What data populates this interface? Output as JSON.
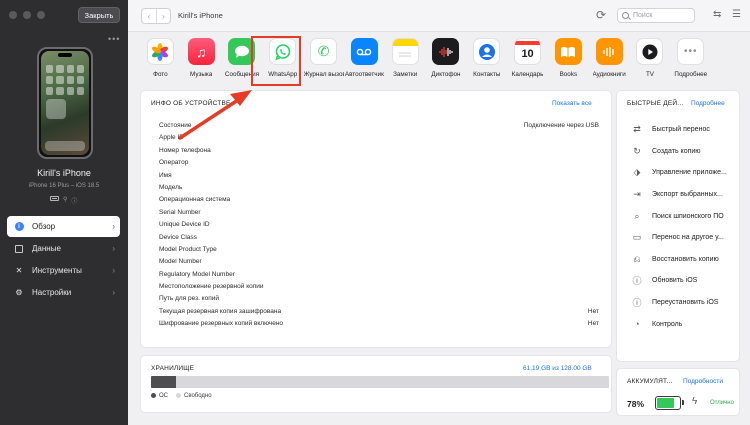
{
  "sidebar": {
    "close_label": "Закрыть",
    "device_name": "Kirill's iPhone",
    "device_model": "iPhone 16 Plus – iOS 18.5",
    "items": [
      {
        "label": "Обзор",
        "icon": "info-icon",
        "active": true
      },
      {
        "label": "Данные",
        "icon": "data-icon",
        "active": false
      },
      {
        "label": "Инструменты",
        "icon": "tools-icon",
        "active": false
      },
      {
        "label": "Настройки",
        "icon": "settings-icon",
        "active": false
      }
    ]
  },
  "topbar": {
    "title": "Kirill's iPhone",
    "search_placeholder": "Поиск"
  },
  "apps": [
    {
      "label": "Фото",
      "icon": "photos-icon"
    },
    {
      "label": "Музыка",
      "icon": "music-icon"
    },
    {
      "label": "Сообщения",
      "icon": "messages-icon"
    },
    {
      "label": "WhatsApp",
      "icon": "whatsapp-icon"
    },
    {
      "label": "Журнал вызовов",
      "icon": "call-log-icon"
    },
    {
      "label": "Автоответчик",
      "icon": "voicemail-icon"
    },
    {
      "label": "Заметки",
      "icon": "notes-icon"
    },
    {
      "label": "Диктофон",
      "icon": "voice-memos-icon"
    },
    {
      "label": "Контакты",
      "icon": "contacts-icon"
    },
    {
      "label": "Календарь",
      "icon": "calendar-icon",
      "day": "10"
    },
    {
      "label": "Books",
      "icon": "books-icon"
    },
    {
      "label": "Аудиокниги",
      "icon": "audiobooks-icon"
    },
    {
      "label": "TV",
      "icon": "tv-icon"
    },
    {
      "label": "Подробнее",
      "icon": "more-icon"
    }
  ],
  "device_info": {
    "title": "ИНФО ОБ УСТРОЙСТВЕ",
    "show_all": "Показать все",
    "rows": [
      {
        "label": "Состояние",
        "value": "Подключение через USB"
      },
      {
        "label": "Apple ID",
        "value": ""
      },
      {
        "label": "Номер телефона",
        "value": ""
      },
      {
        "label": "Оператор",
        "value": ""
      },
      {
        "label": "Имя",
        "value": ""
      },
      {
        "label": "Модель",
        "value": ""
      },
      {
        "label": "Операционная система",
        "value": ""
      },
      {
        "label": "Serial Number",
        "value": ""
      },
      {
        "label": "Unique Device ID",
        "value": ""
      },
      {
        "label": "Device Class",
        "value": ""
      },
      {
        "label": "Model Product Type",
        "value": ""
      },
      {
        "label": "Model Number",
        "value": ""
      },
      {
        "label": "Regulatory Model Number",
        "value": ""
      },
      {
        "label": "Местоположение резервной копии",
        "value": ""
      },
      {
        "label": "Путь для рез. копий",
        "value": ""
      },
      {
        "label": "Текущая резервная копия зашифрована",
        "value": "Нет"
      },
      {
        "label": "Шифрование резервных копий включено",
        "value": "Нет"
      }
    ]
  },
  "quick_actions": {
    "title": "БЫСТРЫЕ ДЕЙ...",
    "more": "Подробнее",
    "items": [
      {
        "label": "Быстрый перенос",
        "icon": "transfer-icon"
      },
      {
        "label": "Создать копию",
        "icon": "backup-icon"
      },
      {
        "label": "Управление приложе...",
        "icon": "apps-manage-icon"
      },
      {
        "label": "Экспорт выбранных...",
        "icon": "export-icon"
      },
      {
        "label": "Поиск шпионского ПО",
        "icon": "spyware-scan-icon"
      },
      {
        "label": "Перенос на другое у...",
        "icon": "device-transfer-icon"
      },
      {
        "label": "Восстановить копию",
        "icon": "restore-icon"
      },
      {
        "label": "Обновить iOS",
        "icon": "ios-update-icon"
      },
      {
        "label": "Переустановить iOS",
        "icon": "ios-reinstall-icon"
      },
      {
        "label": "Контроль",
        "icon": "control-icon"
      }
    ]
  },
  "storage": {
    "title": "ХРАНИЛИЩЕ",
    "summary": "61.19 GB из 128.00 GB",
    "used_fraction": 0.055,
    "legend": [
      {
        "label": "ОС",
        "color": "#4d4d52"
      },
      {
        "label": "Свободно",
        "color": "#d8d8dc"
      }
    ]
  },
  "battery": {
    "title": "АККУМУЛЯТ...",
    "more": "Подробности",
    "percent_label": "78%",
    "level": 0.78,
    "status": "Отлично"
  },
  "colors": {
    "accent": "#1a73e8",
    "highlight": "#e53c26",
    "battery_green": "#34c759"
  }
}
